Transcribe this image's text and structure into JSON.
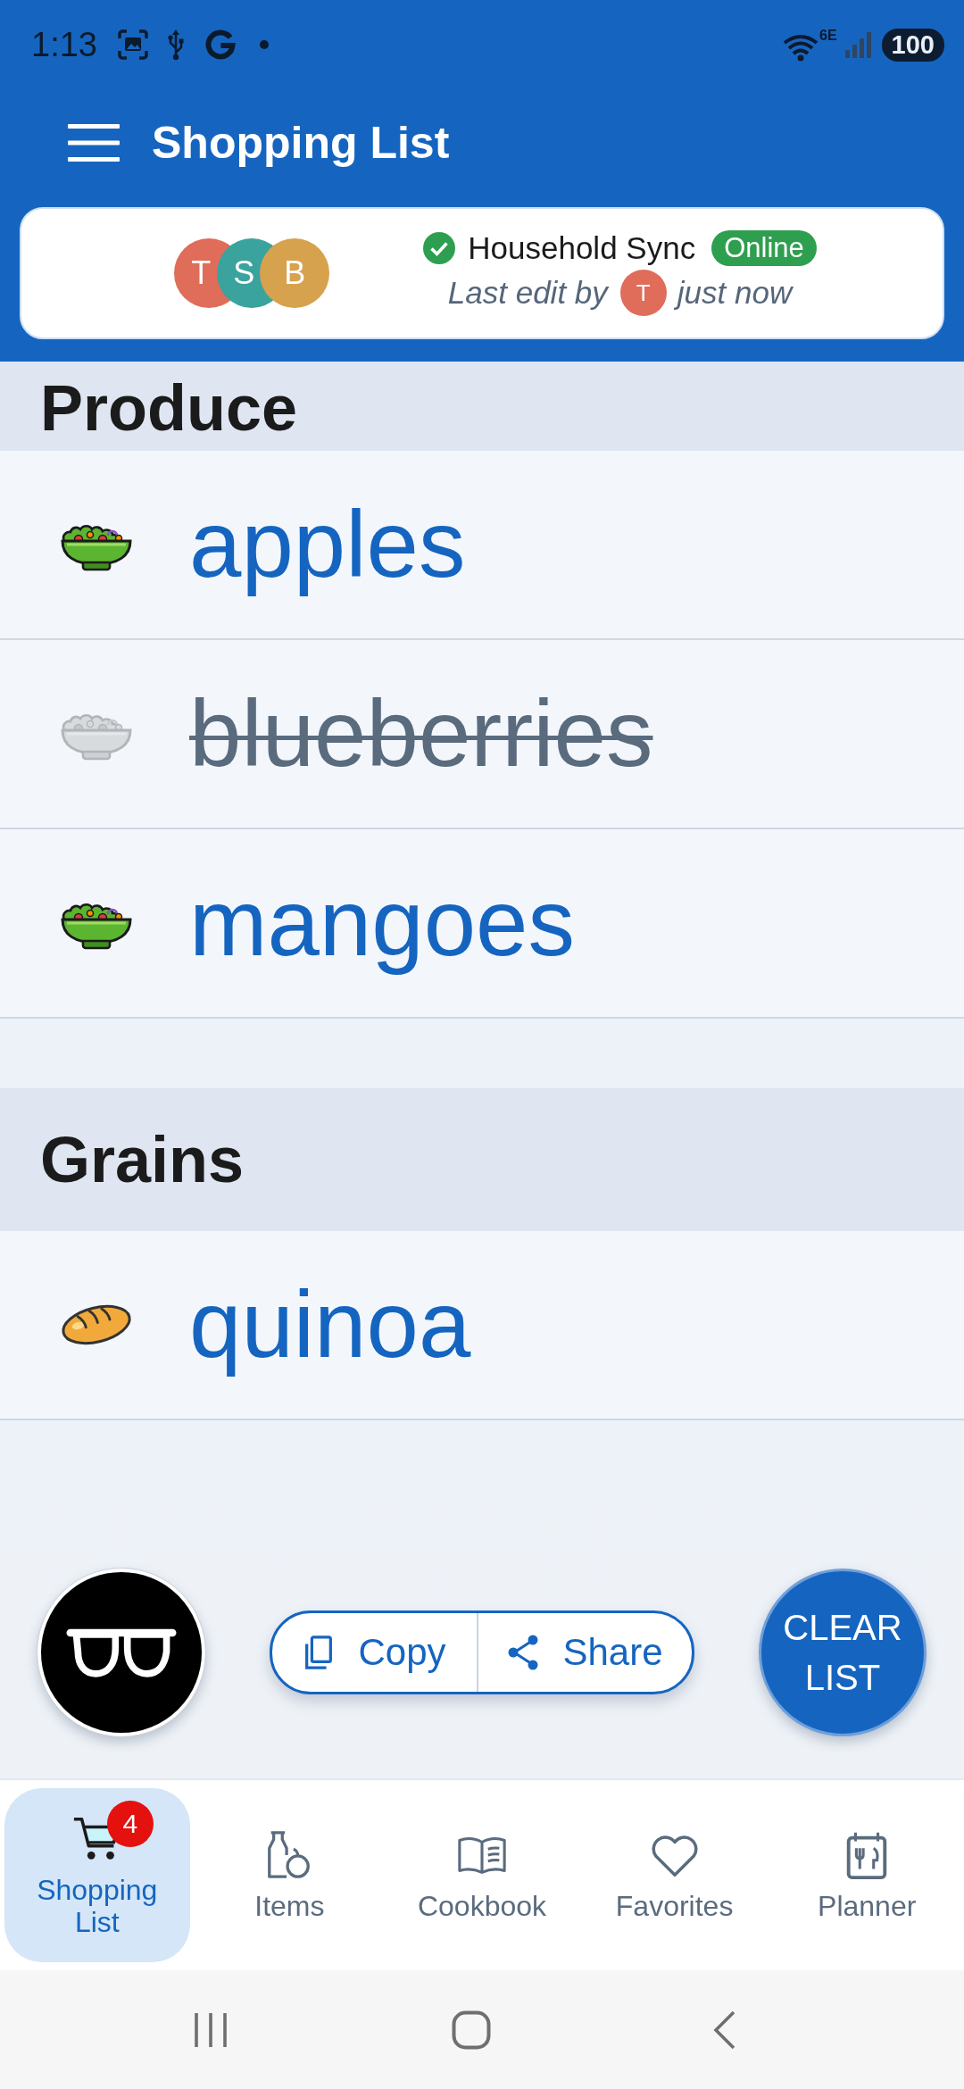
{
  "status_bar": {
    "time": "1:13",
    "network": "6E",
    "battery": "100"
  },
  "app_bar": {
    "title": "Shopping List"
  },
  "sync": {
    "members": [
      {
        "initial": "T",
        "color": "#e06c5a"
      },
      {
        "initial": "S",
        "color": "#3aa39d"
      },
      {
        "initial": "B",
        "color": "#d6a24e"
      }
    ],
    "title": "Household Sync",
    "status": "Online",
    "last_edit_label": "Last edit by",
    "last_editor": {
      "initial": "T",
      "color": "#e06c5a"
    },
    "last_edit_time": "just now"
  },
  "sections": [
    {
      "title": "Produce",
      "kind": "produce",
      "items": [
        {
          "name": "apples",
          "checked": false
        },
        {
          "name": "blueberries",
          "checked": true
        },
        {
          "name": "mangoes",
          "checked": false
        }
      ]
    },
    {
      "title": "Grains",
      "kind": "grains",
      "items": [
        {
          "name": "quinoa",
          "checked": false
        }
      ]
    }
  ],
  "actions": {
    "copy": "Copy",
    "share": "Share",
    "clear": "CLEAR LIST"
  },
  "bottom_nav": [
    {
      "label": "Shopping List",
      "kind": "cart",
      "selected": true,
      "badge": "4"
    },
    {
      "label": "Items",
      "kind": "pantry",
      "selected": false
    },
    {
      "label": "Cookbook",
      "kind": "book",
      "selected": false
    },
    {
      "label": "Favorites",
      "kind": "heart",
      "selected": false
    },
    {
      "label": "Planner",
      "kind": "planner",
      "selected": false
    }
  ]
}
